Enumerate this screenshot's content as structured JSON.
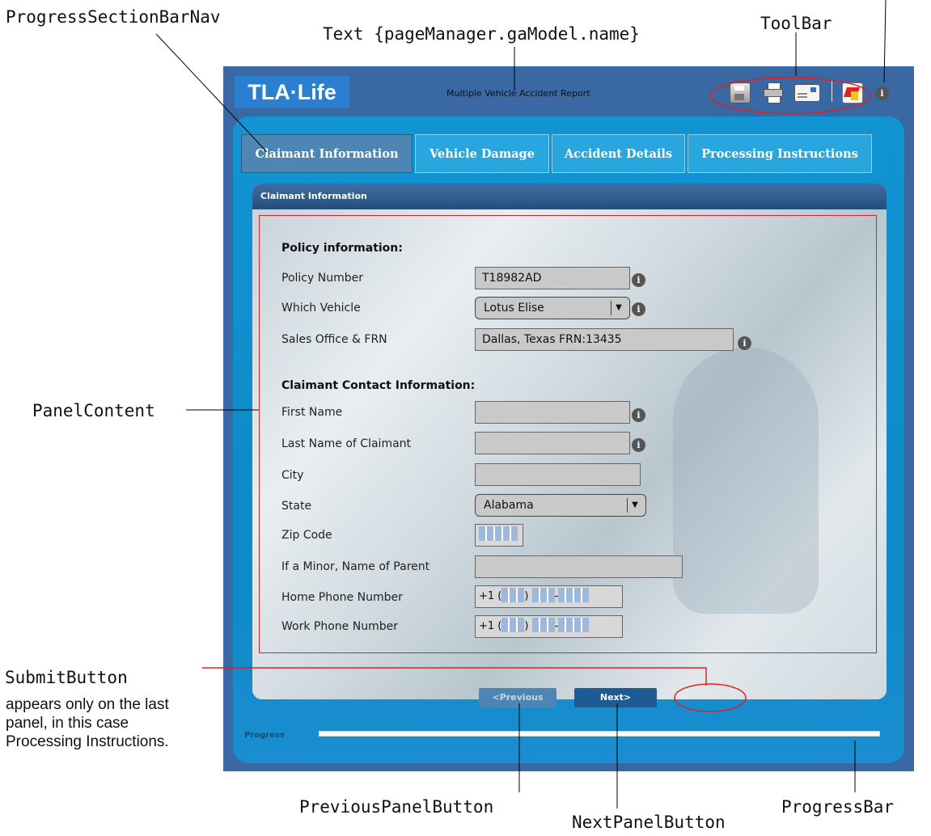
{
  "callouts": {
    "progress_nav": "ProgressSectionBarNav",
    "text_binding": "Text {pageManager.gaModel.name}",
    "toolbar": "ToolBar",
    "panel_content": "PanelContent",
    "submit_button": "SubmitButton",
    "submit_note": "appears only on the last panel, in this case Processing Instructions.",
    "previous_button": "PreviousPanelButton",
    "next_button": "NextPanelButton",
    "progress_bar": "ProgressBar"
  },
  "app": {
    "logo": "TLA·Life",
    "title": "Multiple Vehicle Accident Report",
    "toolbar_icons": [
      "save-icon",
      "print-icon",
      "email-icon",
      "pdf-icon"
    ],
    "info_symbol": "i"
  },
  "tabs": [
    {
      "label": "Claimant Information",
      "active": true
    },
    {
      "label": "Vehicle Damage",
      "active": false
    },
    {
      "label": "Accident Details",
      "active": false
    },
    {
      "label": "Processing Instructions",
      "active": false
    }
  ],
  "panel": {
    "header": "Claimant Information",
    "policy_section": "Policy information:",
    "contact_section": "Claimant Contact Information:",
    "fields": {
      "policy_number": {
        "label": "Policy Number",
        "value": "T18982AD"
      },
      "which_vehicle": {
        "label": "Which Vehicle",
        "value": "Lotus Elise"
      },
      "sales_office": {
        "label": "Sales Office & FRN",
        "value": "Dallas, Texas FRN:13435"
      },
      "first_name": {
        "label": "First Name",
        "value": ""
      },
      "last_name": {
        "label": "Last Name of Claimant",
        "value": ""
      },
      "city": {
        "label": "City",
        "value": ""
      },
      "state": {
        "label": "State",
        "value": "Alabama"
      },
      "zip": {
        "label": "Zip Code"
      },
      "parent": {
        "label": "If a Minor, Name of Parent",
        "value": ""
      },
      "home_phone": {
        "label": "Home Phone Number",
        "prefix": "+1"
      },
      "work_phone": {
        "label": "Work Phone Number",
        "prefix": "+1"
      }
    }
  },
  "buttons": {
    "previous": "<Previous",
    "next": "Next>"
  },
  "progress": {
    "label": "Progress",
    "fraction": 0
  }
}
